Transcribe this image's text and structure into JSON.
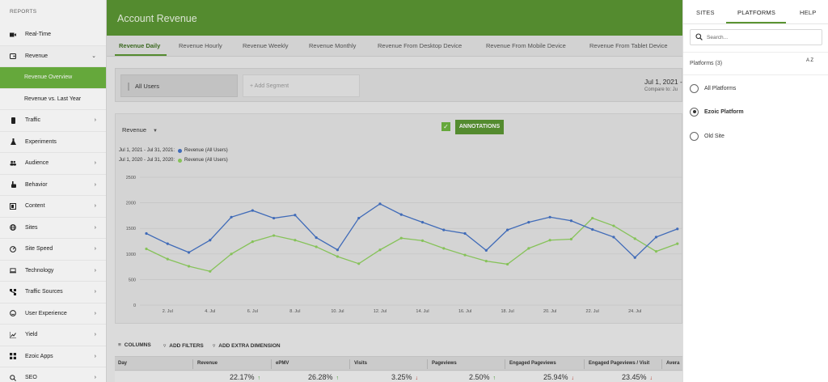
{
  "sidebar": {
    "section_title": "REPORTS",
    "items": [
      {
        "label": "Real-Time",
        "icon": "video-icon",
        "chevron": false
      },
      {
        "label": "Revenue",
        "icon": "wallet-icon",
        "chevron": "down"
      },
      {
        "label": "Revenue Overview",
        "icon": "",
        "chevron": false,
        "sub": true,
        "active": true
      },
      {
        "label": "Revenue vs. Last Year",
        "icon": "",
        "chevron": false,
        "sub": true
      },
      {
        "label": "Traffic",
        "icon": "traffic-light-icon",
        "chevron": "right"
      },
      {
        "label": "Experiments",
        "icon": "flask-icon",
        "chevron": false
      },
      {
        "label": "Audience",
        "icon": "users-icon",
        "chevron": "right"
      },
      {
        "label": "Behavior",
        "icon": "hand-pointer-icon",
        "chevron": "right"
      },
      {
        "label": "Content",
        "icon": "content-icon",
        "chevron": "right"
      },
      {
        "label": "Sites",
        "icon": "globe-icon",
        "chevron": "right"
      },
      {
        "label": "Site Speed",
        "icon": "speedometer-icon",
        "chevron": "right"
      },
      {
        "label": "Technology",
        "icon": "laptop-icon",
        "chevron": "right"
      },
      {
        "label": "Traffic Sources",
        "icon": "network-icon",
        "chevron": "right"
      },
      {
        "label": "User Experience",
        "icon": "smile-icon",
        "chevron": "right"
      },
      {
        "label": "Yield",
        "icon": "line-chart-icon",
        "chevron": "right"
      },
      {
        "label": "Ezoic Apps",
        "icon": "apps-icon",
        "chevron": "right"
      },
      {
        "label": "SEO",
        "icon": "seo-icon",
        "chevron": "right"
      }
    ]
  },
  "header": {
    "title": "Account Revenue"
  },
  "tabs": [
    "Revenue Daily",
    "Revenue Hourly",
    "Revenue Weekly",
    "Revenue Monthly",
    "Revenue From Desktop Device",
    "Revenue From Mobile Device",
    "Revenue From Tablet Device"
  ],
  "segments": {
    "current": "All Users",
    "add_placeholder": "+ Add Segment",
    "date_range": "Jul 1, 2021 -",
    "compare_to": "Compare to: Ju"
  },
  "chart_controls": {
    "metric": "Revenue",
    "annotations_label": "ANNOTATIONS",
    "annotations_checked": true
  },
  "legend": [
    {
      "range": "Jul 1, 2021 - Jul 31, 2021:",
      "series": "Revenue (All Users)",
      "color": "#4472c4"
    },
    {
      "range": "Jul 1, 2020 - Jul 31, 2020:",
      "series": "Revenue (All Users)",
      "color": "#8fcf5f"
    }
  ],
  "chart_data": {
    "type": "line",
    "x": [
      1,
      2,
      3,
      4,
      5,
      6,
      7,
      8,
      9,
      10,
      11,
      12,
      13,
      14,
      15,
      16,
      17,
      18,
      19,
      20,
      21,
      22,
      23,
      24,
      25,
      26
    ],
    "ylim": [
      0,
      2500
    ],
    "yticks": [
      0,
      500,
      1000,
      1500,
      2000,
      2500
    ],
    "xtick_labels": [
      "2. Jul",
      "4. Jul",
      "6. Jul",
      "8. Jul",
      "10. Jul",
      "12. Jul",
      "14. Jul",
      "16. Jul",
      "18. Jul",
      "20. Jul",
      "22. Jul",
      "24. Jul"
    ],
    "xtick_positions": [
      2,
      4,
      6,
      8,
      10,
      12,
      14,
      16,
      18,
      20,
      22,
      24
    ],
    "series": [
      {
        "name": "Jul 1, 2021 - Jul 31, 2021: Revenue (All Users)",
        "color": "#4472c4",
        "values": [
          1400,
          1200,
          1030,
          1270,
          1720,
          1850,
          1700,
          1760,
          1320,
          1080,
          1700,
          1980,
          1770,
          1620,
          1470,
          1400,
          1070,
          1470,
          1620,
          1720,
          1650,
          1480,
          1330,
          930,
          1330,
          1490
        ]
      },
      {
        "name": "Jul 1, 2020 - Jul 31, 2020: Revenue (All Users)",
        "color": "#8fcf5f",
        "values": [
          1100,
          900,
          760,
          660,
          1000,
          1240,
          1360,
          1270,
          1140,
          950,
          810,
          1080,
          1310,
          1260,
          1110,
          980,
          860,
          800,
          1110,
          1270,
          1290,
          1700,
          1550,
          1300,
          1050,
          1200
        ]
      }
    ]
  },
  "table": {
    "toolbar": [
      "COLUMNS",
      "ADD FILTERS",
      "ADD EXTRA DIMENSION"
    ],
    "headers": [
      "Day",
      "Revenue",
      "ePMV",
      "Visits",
      "Pageviews",
      "Engaged Pageviews",
      "Engaged Pageviews / Visit",
      "Avera"
    ],
    "summary": [
      {
        "value": "",
        "dir": ""
      },
      {
        "value": "22.17%",
        "dir": "up"
      },
      {
        "value": "26.28%",
        "dir": "up"
      },
      {
        "value": "3.25%",
        "dir": "down"
      },
      {
        "value": "2.50%",
        "dir": "up"
      },
      {
        "value": "25.94%",
        "dir": "down"
      },
      {
        "value": "23.45%",
        "dir": "down"
      }
    ]
  },
  "right_panel": {
    "tabs": [
      "SITES",
      "PLATFORMS",
      "HELP"
    ],
    "active_tab": "PLATFORMS",
    "search_placeholder": "Search...",
    "platforms_title": "Platforms (3)",
    "sort_label": "A Z",
    "options": [
      {
        "label": "All Platforms",
        "selected": false
      },
      {
        "label": "Ezoic Platform",
        "selected": true
      },
      {
        "label": "Old Site",
        "selected": false
      }
    ]
  }
}
